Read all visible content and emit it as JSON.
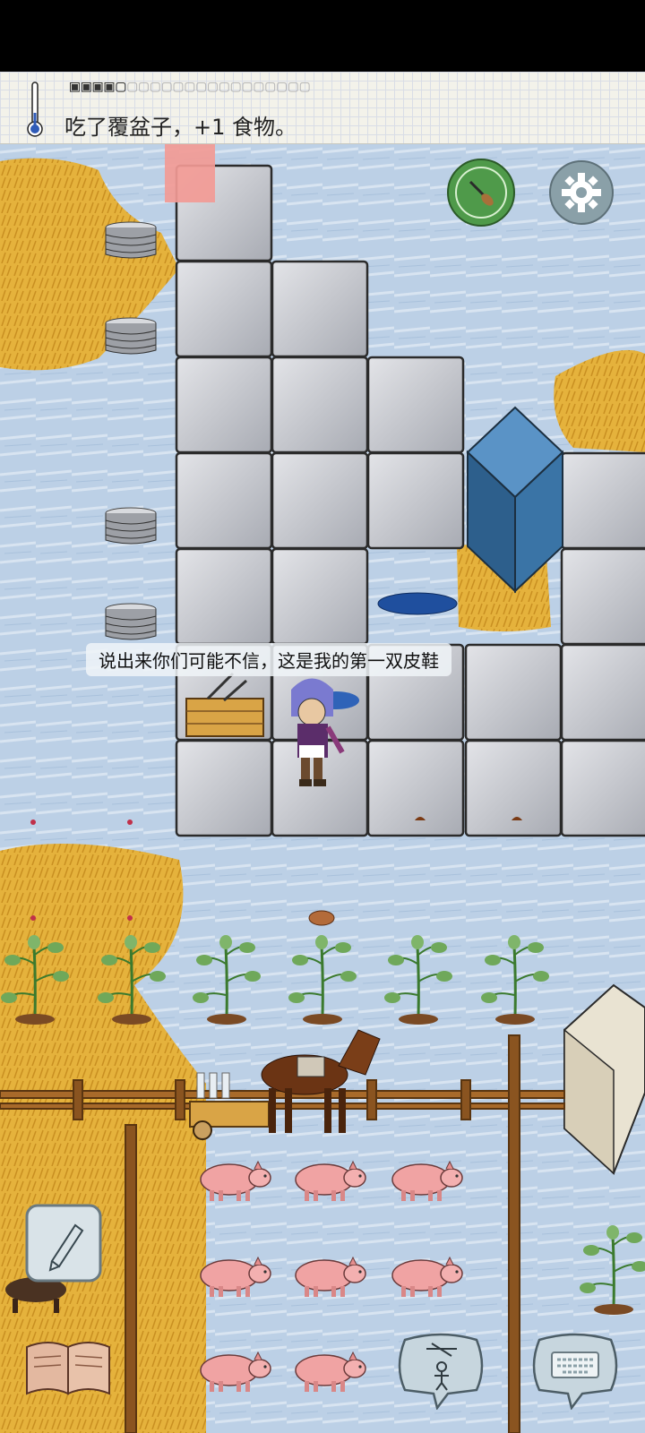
{
  "hud": {
    "message": "吃了覆盆子，+1 食物。",
    "food_pips_full": "▣▣▣▣▢",
    "food_pips_empty": "▢▢▢▢▢▢▢▢▢▢▢▢▢▢▢▢"
  },
  "speech_text": "说出来你们可能不信，这是我的第一双皮鞋",
  "buttons": {
    "compass": "compass-icon",
    "settings": "gear-icon",
    "edit": "pencil-icon",
    "book": "book-icon",
    "emote": "puppet-icon",
    "keyboard": "keyboard-icon"
  },
  "colors": {
    "snow": "#b9cfe6",
    "stone": "#c4c6cc",
    "wheat": "#e6b23a",
    "blue_block": "#2f6b9c",
    "compass_green": "#4f9a4a",
    "settings_gray": "#8aa0a8"
  }
}
